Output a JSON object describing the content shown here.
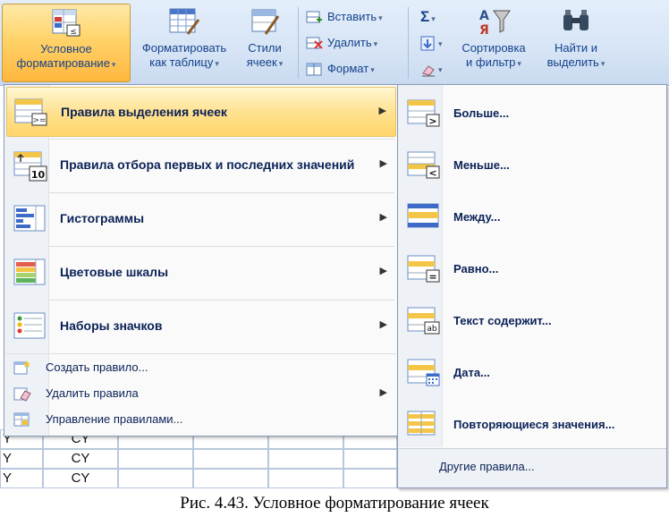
{
  "ribbon": {
    "conditional_formatting": {
      "line1": "Условное",
      "line2": "форматирование"
    },
    "format_as_table": {
      "line1": "Форматировать",
      "line2": "как таблицу"
    },
    "cell_styles": {
      "line1": "Стили",
      "line2": "ячеек"
    },
    "insert": "Вставить",
    "delete": "Удалить",
    "format": "Формат",
    "sum_symbol": "Σ",
    "sort_filter": {
      "line1": "Сортировка",
      "line2": "и фильтр"
    },
    "find_select": {
      "line1": "Найти и",
      "line2": "выделить"
    },
    "dropdown_arrow": "▾"
  },
  "sheet": {
    "left_cells": [
      "Y",
      "Y",
      "Y"
    ],
    "cells": [
      "CY",
      "CY",
      "CY"
    ]
  },
  "menu": {
    "items": [
      {
        "label": "Правила выделения ячеек",
        "has_submenu": true
      },
      {
        "label": "Правила отбора первых и последних значений",
        "has_submenu": true
      },
      {
        "label": "Гистограммы",
        "has_submenu": true
      },
      {
        "label": "Цветовые шкалы",
        "has_submenu": true
      },
      {
        "label": "Наборы значков",
        "has_submenu": true
      }
    ],
    "small_items": [
      {
        "label": "Создать правило..."
      },
      {
        "label": "Удалить правила",
        "has_submenu": true
      },
      {
        "label": "Управление правилами..."
      }
    ],
    "submenu_arrow": "▶",
    "top10_number": "10"
  },
  "submenu": {
    "items": [
      {
        "label": "Больше..."
      },
      {
        "label": "Меньше..."
      },
      {
        "label": "Между..."
      },
      {
        "label": "Равно..."
      },
      {
        "label": "Текст содержит..."
      },
      {
        "label": "Дата..."
      },
      {
        "label": "Повторяющиеся значения..."
      }
    ],
    "more_rules": "Другие правила...",
    "glyph_gt": ">",
    "glyph_lt": "<",
    "glyph_eq": "=",
    "glyph_ab": "ab"
  },
  "caption": "Рис. 4.43. Условное форматирование ячеек",
  "colors": {
    "hover_gold": "#ffd56a",
    "ribbon_blue": "#d6e4f5",
    "menu_text": "#0b2257"
  }
}
